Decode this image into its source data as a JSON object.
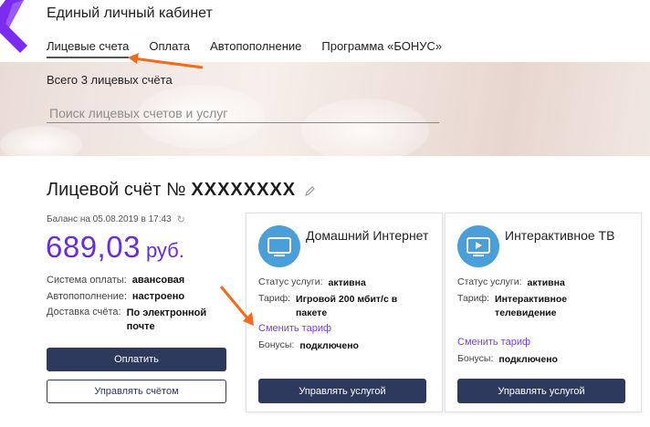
{
  "header": {
    "app_title": "Единый личный кабинет",
    "nav": [
      {
        "label": "Лицевые счета",
        "active": true
      },
      {
        "label": "Оплата",
        "active": false
      },
      {
        "label": "Автопополнение",
        "active": false
      },
      {
        "label": "Программа «БОНУС»",
        "active": false
      }
    ]
  },
  "hero": {
    "accounts_count": "Всего 3 лицевых счёта",
    "search_placeholder": "Поиск лицевых счетов и услуг"
  },
  "account": {
    "title_prefix": "Лицевой счёт №",
    "number": "XXXXXXXX",
    "balance_date": "Баланс на 05.08.2019 в 17:43",
    "balance_amount": "689,03",
    "balance_currency": "руб.",
    "payment_system_label": "Система оплаты:",
    "payment_system_value": "авансовая",
    "autopay_label": "Автопополнение:",
    "autopay_value": "настроено",
    "delivery_label": "Доставка счёта:",
    "delivery_value": "По электронной почте",
    "pay_button": "Оплатить",
    "manage_button": "Управлять счётом"
  },
  "services": [
    {
      "title": "Домашний Интернет",
      "status_label": "Статус услуги:",
      "status_value": "активна",
      "tariff_label": "Тариф:",
      "tariff_value": "Игровой 200 мбит/с в пакете",
      "change_link": "Сменить тариф",
      "bonus_label": "Бонусы:",
      "bonus_value": "подключено",
      "manage_button": "Управлять услугой",
      "icon": "monitor-icon"
    },
    {
      "title": "Интерактивное ТВ",
      "status_label": "Статус услуги:",
      "status_value": "активна",
      "tariff_label": "Тариф:",
      "tariff_value": "Интерактивное телевидение",
      "change_link": "Сменить тариф",
      "bonus_label": "Бонусы:",
      "bonus_value": "подключено",
      "manage_button": "Управлять услугой",
      "icon": "tv-play-icon"
    }
  ],
  "colors": {
    "brand_purple": "#7b2cf0",
    "balance_purple": "#6a2ed6",
    "button_navy": "#2d3a5e",
    "icon_blue": "#4a9fd8",
    "annotation_orange": "#f26a1b"
  }
}
